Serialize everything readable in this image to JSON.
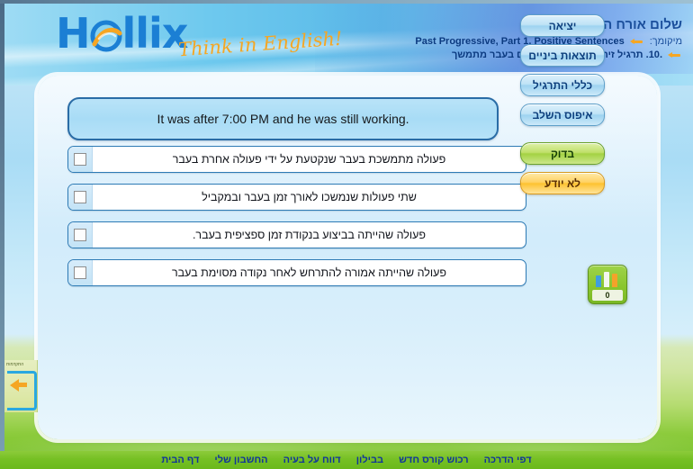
{
  "brand": {
    "logo_before": "H",
    "logo_after": "llix",
    "logo_icon": "swirl-e-icon",
    "tagline": "Think in English!"
  },
  "header": {
    "greeting": "שלום אורח הדגמה",
    "location_label": "מיקומך:",
    "location_value": "Past Progressive, Part 1, Positive Sentences",
    "exercise_value": ".10. תרגיל זיהוי שימוש של פעלים בעבר מתמשך"
  },
  "question": {
    "text": "It was after 7:00 PM and he was still working."
  },
  "answers": [
    {
      "text": "פעולה מתמשכת בעבר שנקטעת על ידי פעולה אחרת בעבר",
      "checked": false
    },
    {
      "text": "שתי פעולות שנמשכו לאורך זמן בעבר ובמקביל",
      "checked": false
    },
    {
      "text": "פעולה שהייתה בביצוע בנקודת זמן ספציפית בעבר.",
      "checked": false
    },
    {
      "text": "פעולה שהייתה אמורה להתרחש לאחר נקודה מסוימת בעבר",
      "checked": false
    }
  ],
  "sidebar": {
    "buttons": [
      {
        "label": "יציאה",
        "style": "blue"
      },
      {
        "label": "תוצאות ביניים",
        "style": "blue"
      },
      {
        "label": "כללי התרגיל",
        "style": "blue"
      },
      {
        "label": "איפוס השלב",
        "style": "blue"
      },
      {
        "label": "בדוק",
        "style": "green"
      },
      {
        "label": "לא יודע",
        "style": "orange"
      }
    ]
  },
  "score": {
    "value": "0",
    "icon": "bar-chart-icon"
  },
  "side_tab": {
    "label": "התקדמות",
    "icon": "arrow-left-icon"
  },
  "footer": {
    "links": [
      "דף הבית",
      "החשבון שלי",
      "דווח על בעיה",
      "בבילון",
      "רכוש קורס חדש",
      "דפי הדרכה"
    ]
  },
  "colors": {
    "brand_blue": "#1b7fd4",
    "tagline_orange": "#f5a623",
    "check_green": "#8ac62f",
    "dontknow_orange": "#fdc230",
    "footer_green": "#76c024"
  }
}
